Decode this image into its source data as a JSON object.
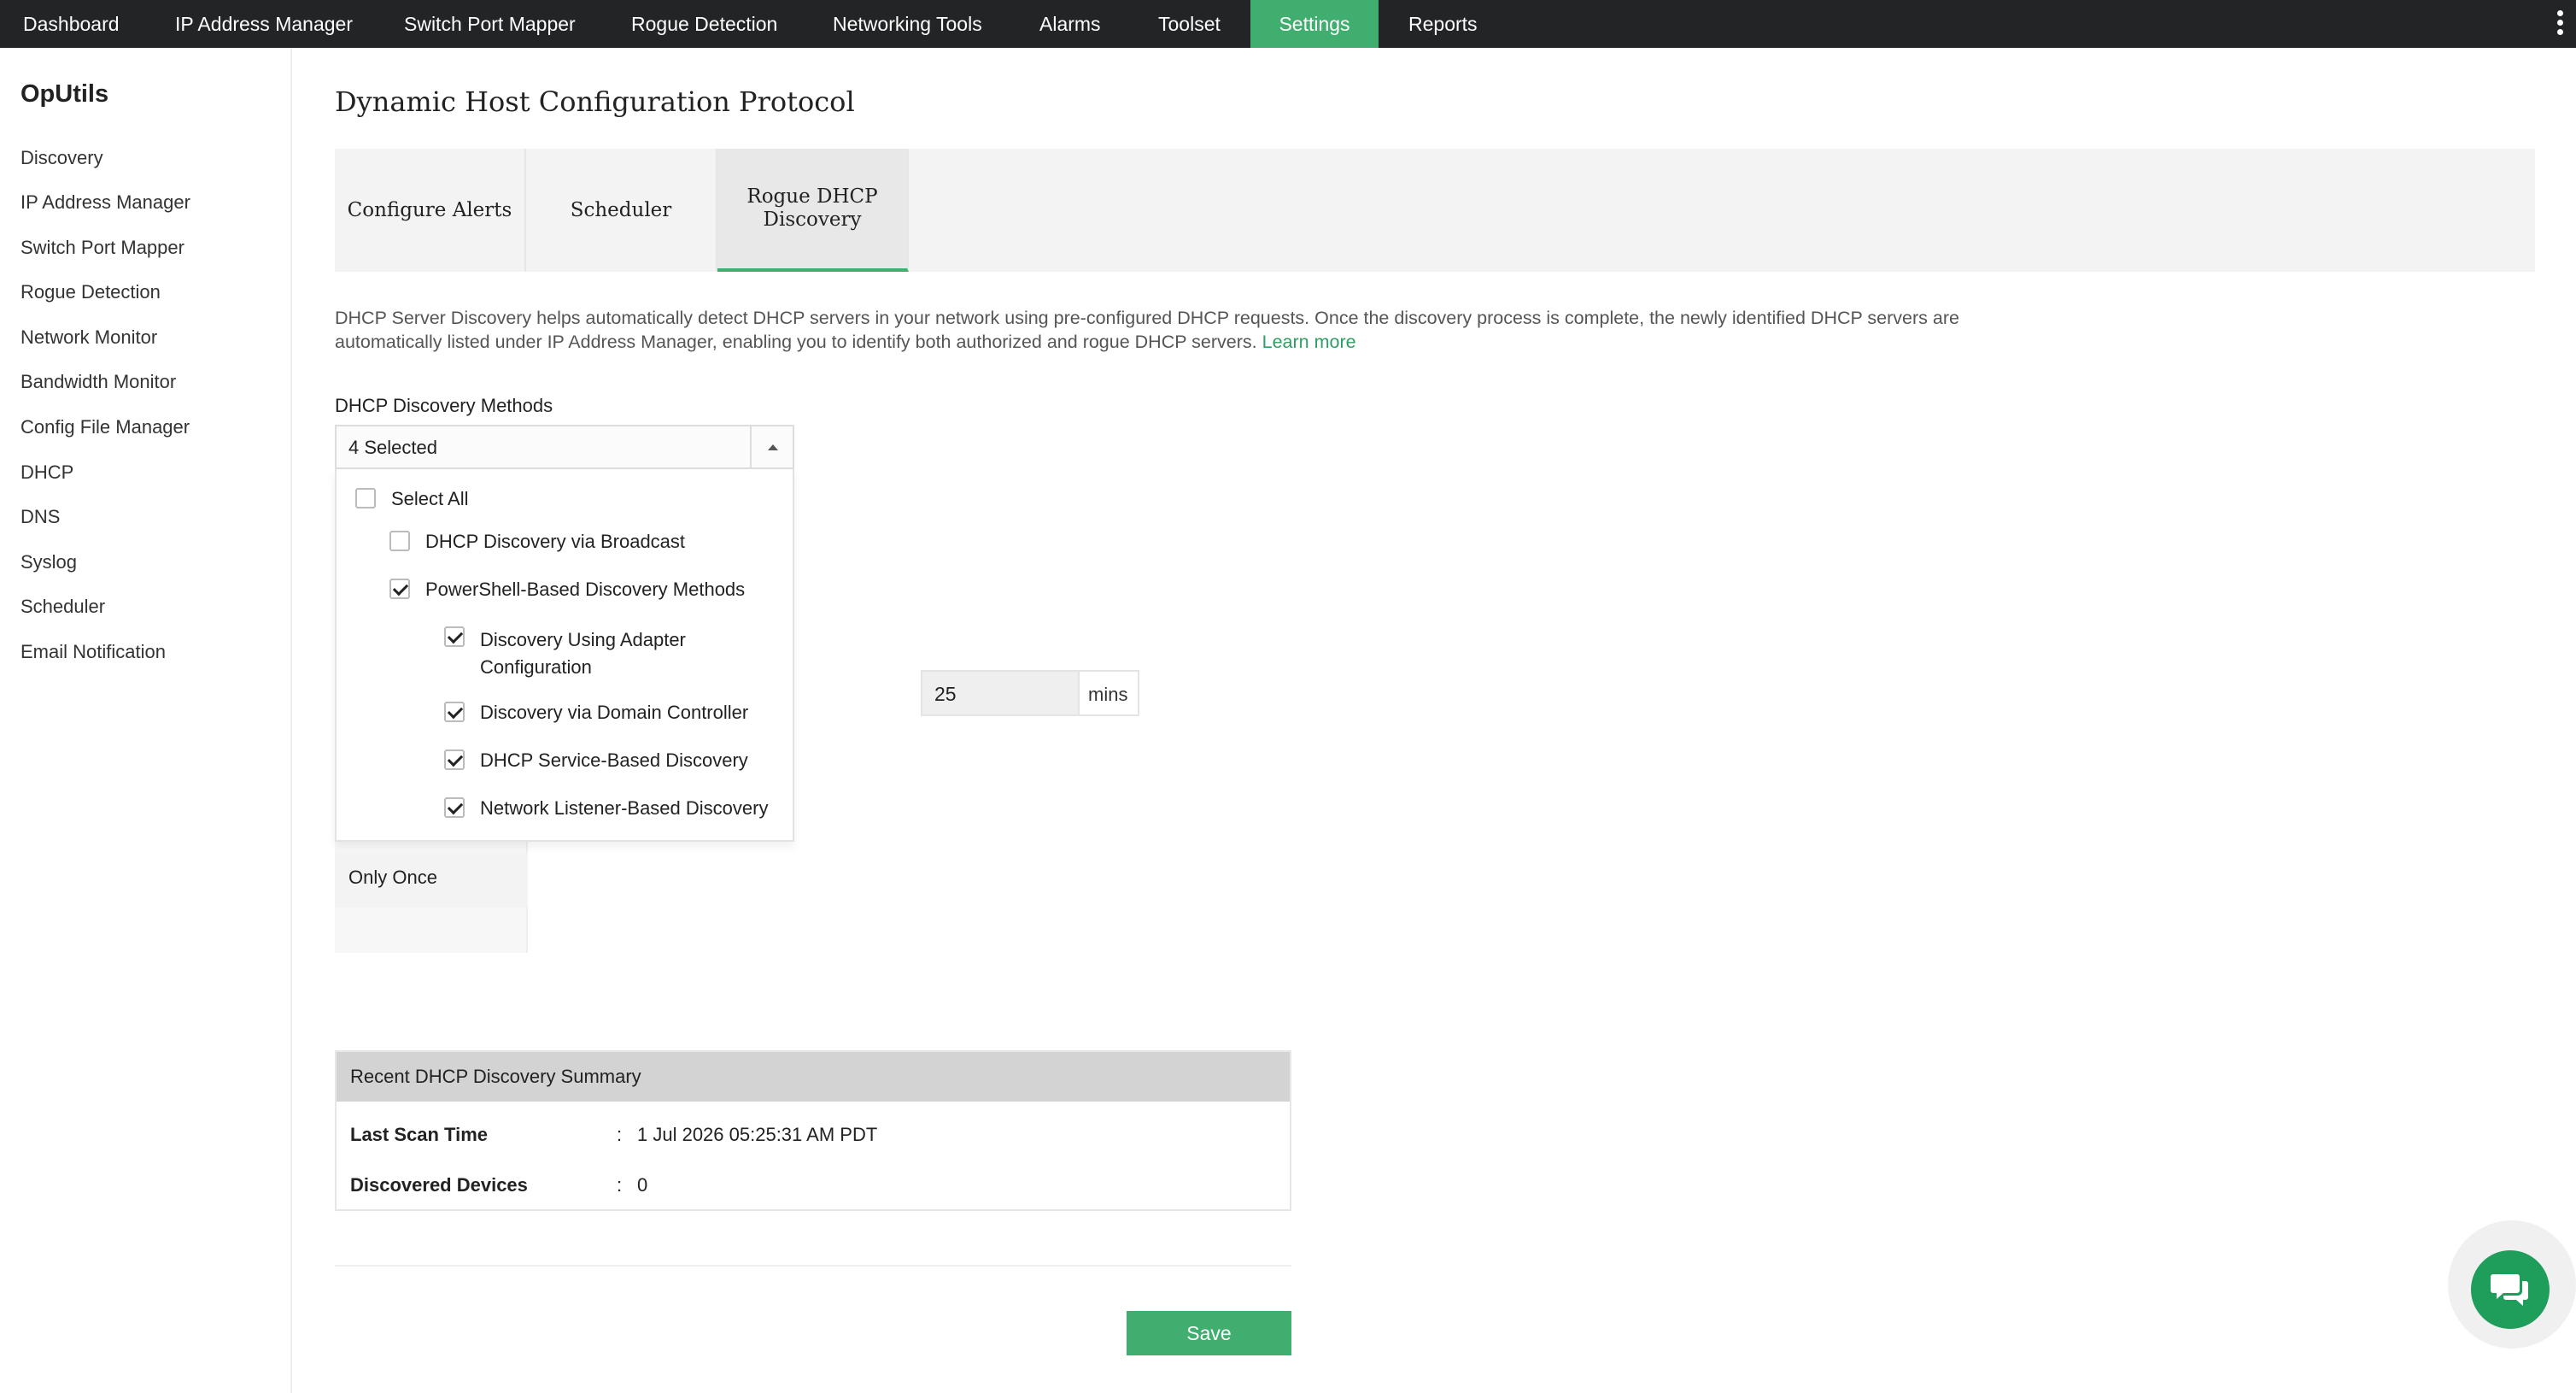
{
  "topnav": {
    "items": [
      {
        "label": "Dashboard"
      },
      {
        "label": "IP Address Manager"
      },
      {
        "label": "Switch Port Mapper"
      },
      {
        "label": "Rogue Detection"
      },
      {
        "label": "Networking Tools"
      },
      {
        "label": "Alarms"
      },
      {
        "label": "Toolset"
      },
      {
        "label": "Settings",
        "active": true
      },
      {
        "label": "Reports"
      }
    ]
  },
  "sidebar": {
    "brand": "OpUtils",
    "items": [
      {
        "label": "Discovery"
      },
      {
        "label": "IP Address Manager"
      },
      {
        "label": "Switch Port Mapper"
      },
      {
        "label": "Rogue Detection"
      },
      {
        "label": "Network Monitor"
      },
      {
        "label": "Bandwidth Monitor"
      },
      {
        "label": "Config File Manager"
      },
      {
        "label": "DHCP"
      },
      {
        "label": "DNS"
      },
      {
        "label": "Syslog"
      },
      {
        "label": "Scheduler"
      },
      {
        "label": "Email Notification"
      }
    ]
  },
  "main": {
    "title": "Dynamic Host Configuration Protocol",
    "tabs": [
      {
        "label": "Configure Alerts"
      },
      {
        "label": "Scheduler"
      },
      {
        "label": "Rogue DHCP Discovery",
        "active": true
      }
    ],
    "description": "DHCP Server Discovery helps automatically detect DHCP servers in your network using pre-configured DHCP requests. Once the discovery process is complete, the newly identified DHCP servers are automatically listed under IP Address Manager, enabling you to identify both authorized and rogue DHCP servers.",
    "learn_more": "Learn more",
    "methods_label": "DHCP Discovery Methods",
    "methods_select": {
      "value": "4 Selected",
      "options": [
        {
          "label": "Select All",
          "checked": false
        },
        {
          "label": "DHCP Discovery via Broadcast",
          "checked": false
        },
        {
          "label": "PowerShell-Based Discovery Methods",
          "checked": true
        },
        {
          "label": "Discovery Using Adapter Configuration",
          "checked": true
        },
        {
          "label": "Discovery via Domain Controller",
          "checked": true
        },
        {
          "label": "DHCP Service-Based Discovery",
          "checked": true
        },
        {
          "label": "Network Listener-Based Discovery",
          "checked": true
        }
      ]
    },
    "interval": {
      "value": "25",
      "unit": "mins"
    },
    "frequency_option": "Only Once",
    "summary": {
      "heading": "Recent DHCP Discovery Summary",
      "colon": ":",
      "rows": [
        {
          "label": "Last Scan Time",
          "value": "1 Jul 2026 05:25:31 AM PDT"
        },
        {
          "label": "Discovered Devices",
          "value": "0"
        }
      ]
    },
    "save_label": "Save"
  },
  "colors": {
    "accent": "#3fae6e",
    "topnav_bg": "#222426",
    "chat_button": "#1e9e5a"
  },
  "icons": {
    "chat": "chat-bubbles-icon",
    "more": "kebab-menu-icon",
    "dropdown": "caret-up-icon"
  }
}
